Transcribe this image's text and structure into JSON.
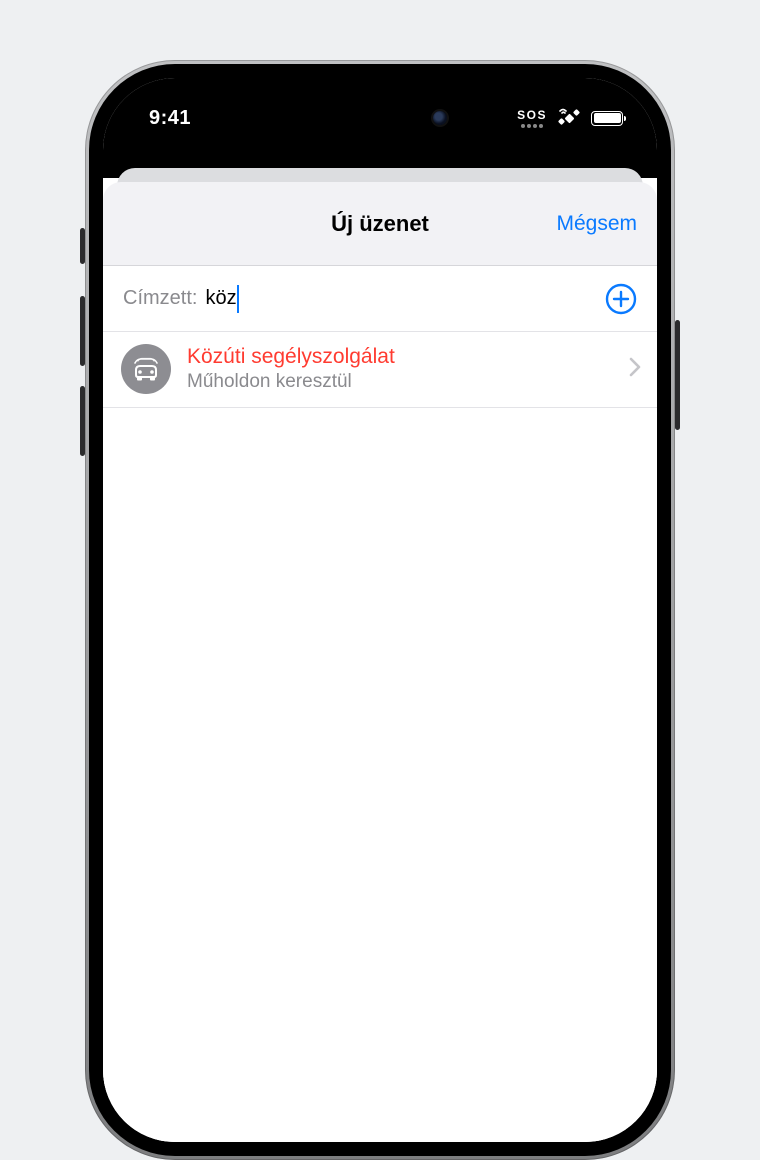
{
  "status": {
    "time": "9:41",
    "sos": "SOS"
  },
  "sheet": {
    "title": "Új üzenet",
    "cancel": "Mégsem"
  },
  "to": {
    "label": "Címzett:",
    "value": "köz"
  },
  "result": {
    "title": "Közúti segélyszolgálat",
    "subtitle": "Műholdon keresztül"
  }
}
